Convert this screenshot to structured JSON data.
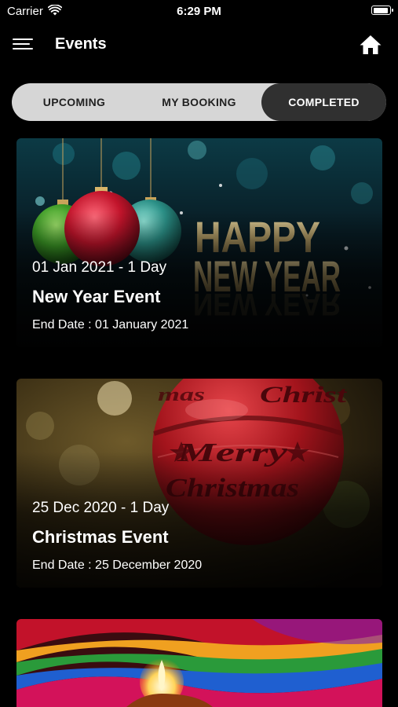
{
  "status_bar": {
    "carrier": "Carrier",
    "time": "6:29 PM",
    "battery_level": 0.95
  },
  "nav": {
    "title": "Events",
    "menu_icon": "hamburger-menu-icon",
    "home_icon": "home-icon"
  },
  "tabs": [
    {
      "label": "UPCOMING",
      "active": false
    },
    {
      "label": "MY BOOKING",
      "active": false
    },
    {
      "label": "COMPLETED",
      "active": true
    }
  ],
  "events": [
    {
      "date_line": "01 Jan 2021 - 1 Day",
      "title": "New Year Event",
      "end_date": "End Date : 01 January 2021",
      "image_text": "HAPPY NEW YEAR"
    },
    {
      "date_line": "25 Dec 2020 - 1 Day",
      "title": "Christmas Event",
      "end_date": "End Date : 25 December 2020",
      "image_text": "Merry Christmas"
    },
    {
      "date_line": "",
      "title": "",
      "end_date": ""
    }
  ],
  "colors": {
    "background": "#000000",
    "tab_bar": "#d6d6d6",
    "tab_active": "#303030"
  }
}
